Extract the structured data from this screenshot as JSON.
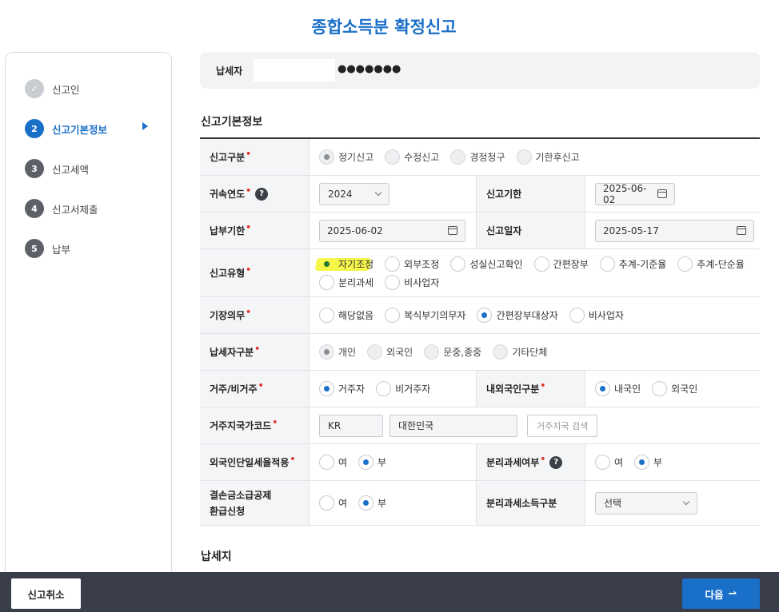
{
  "page": {
    "title": "종합소득분 확정신고"
  },
  "sidebar": {
    "steps": [
      {
        "num": "✓",
        "label": "신고인"
      },
      {
        "num": "2",
        "label": "신고기본정보"
      },
      {
        "num": "3",
        "label": "신고세액"
      },
      {
        "num": "4",
        "label": "신고서제출"
      },
      {
        "num": "5",
        "label": "납부"
      }
    ]
  },
  "taxpayer": {
    "label": "납세자",
    "masked": "●●●●●●●"
  },
  "sections": {
    "basic": "신고기본정보",
    "notice": "납세지"
  },
  "form": {
    "report_type": {
      "label": "신고구분",
      "options": [
        "정기신고",
        "수정신고",
        "경정청구",
        "기한후신고"
      ]
    },
    "year": {
      "label": "귀속연도",
      "help": "?",
      "value": "2024"
    },
    "deadline": {
      "label": "신고기한",
      "value": "2025-06-02"
    },
    "pay_deadline": {
      "label": "납부기한",
      "value": "2025-06-02"
    },
    "report_date": {
      "label": "신고일자",
      "value": "2025-05-17"
    },
    "report_kind": {
      "label": "신고유형",
      "options": [
        "자기조정",
        "외부조정",
        "성실신고확인",
        "간편장부",
        "추계-기준율",
        "추계-단순율",
        "분리과세",
        "비사업자"
      ]
    },
    "bookkeeping": {
      "label": "기장의무",
      "options": [
        "해당없음",
        "복식부기의무자",
        "간편장부대상자",
        "비사업자"
      ]
    },
    "taxpayer_type": {
      "label": "납세자구분",
      "options": [
        "개인",
        "외국인",
        "문중,종중",
        "기타단체"
      ]
    },
    "residency": {
      "label": "거주/비거주",
      "options": [
        "거주자",
        "비거주자"
      ]
    },
    "nationality": {
      "label": "내외국인구분",
      "options": [
        "내국인",
        "외국인"
      ]
    },
    "country": {
      "label": "거주지국가코드",
      "code": "KR",
      "name": "대한민국",
      "search_button": "거주지국 검색"
    },
    "foreign_flat": {
      "label": "외국인단일세율적용",
      "options": [
        "여",
        "부"
      ]
    },
    "separate_tax": {
      "label": "분리과세여부",
      "help": "?",
      "options": [
        "여",
        "부"
      ]
    },
    "loss_refund": {
      "label_line1": "결손금소급공제",
      "label_line2": "환급신청",
      "options": [
        "여",
        "부"
      ]
    },
    "separate_income": {
      "label": "분리과세소득구분",
      "value": "선택"
    }
  },
  "bottom": {
    "cancel": "신고취소",
    "next": "다음",
    "next_icon": "⇀"
  },
  "colors": {
    "accent": "#1a6fc9",
    "required": "#e0332b",
    "bottombar": "#3a3d4a",
    "highlight": "#f5f52a"
  }
}
